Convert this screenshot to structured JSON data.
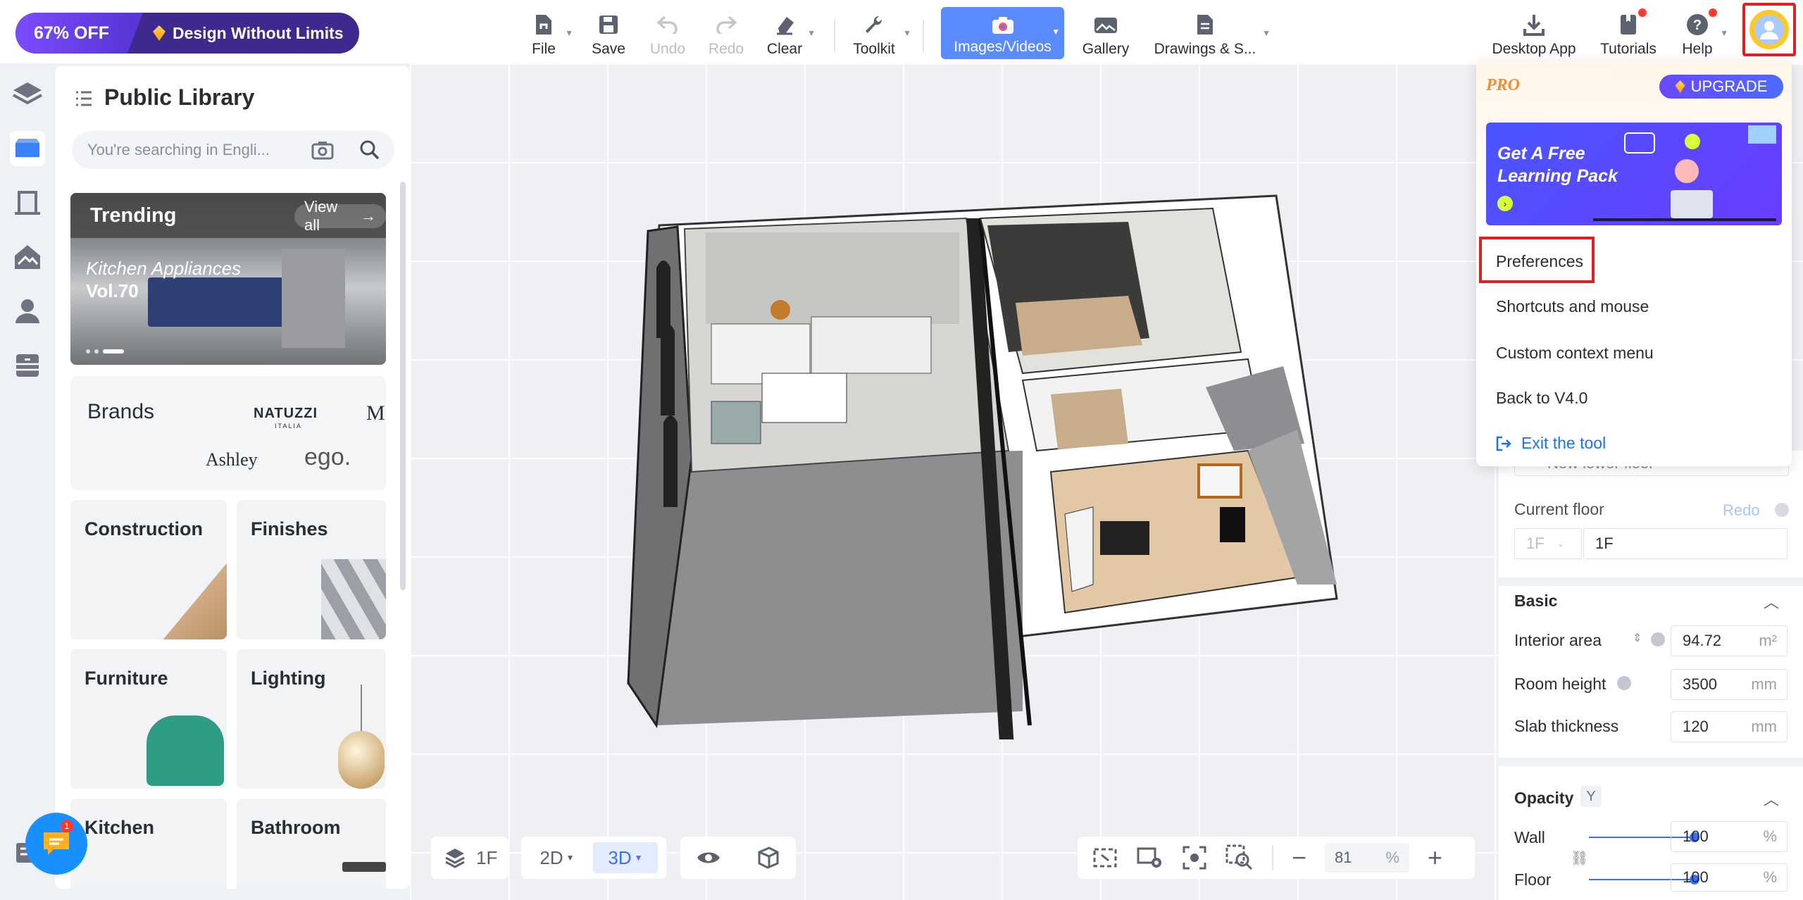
{
  "promo": {
    "discount": "67% OFF",
    "message": "Design Without Limits"
  },
  "toolbar": {
    "file": "File",
    "save": "Save",
    "undo": "Undo",
    "redo": "Redo",
    "clear": "Clear",
    "toolkit": "Toolkit",
    "images_videos": "Images/Videos",
    "gallery": "Gallery",
    "drawings": "Drawings & S...",
    "desktop_app": "Desktop App",
    "tutorials": "Tutorials",
    "help": "Help"
  },
  "library": {
    "title": "Public Library",
    "search_placeholder": "You're searching in Engli...",
    "trending": {
      "label": "Trending",
      "view_all": "View all",
      "feature_line1": "Kitchen Appliances",
      "feature_line2": "Vol.70"
    },
    "brands": {
      "label": "Brands",
      "logos": [
        "NATUZZI",
        "ITALIA",
        "Ashley",
        "ego.",
        "M"
      ]
    },
    "categories": [
      "Construction",
      "Finishes",
      "Furniture",
      "Lighting",
      "Kitchen",
      "Bathroom"
    ]
  },
  "bottom": {
    "floor": "1F",
    "view_2d": "2D",
    "view_3d": "3D",
    "zoom": "81",
    "zoom_unit": "%"
  },
  "panel": {
    "new_lower_floor": "New lower floor",
    "current_floor_label": "Current floor",
    "redo": "Redo",
    "floor_select": "1F",
    "floor_name": "1F",
    "basic_title": "Basic",
    "interior_area_label": "Interior area",
    "interior_area": "94.72",
    "area_unit": "m²",
    "room_height_label": "Room height",
    "room_height": "3500",
    "slab_label": "Slab thickness",
    "slab": "120",
    "mm": "mm",
    "opacity_title": "Opacity",
    "opacity_key": "Y",
    "wall_label": "Wall",
    "wall_value": "100",
    "floor_label": "Floor",
    "floor_value": "100",
    "pct": "%"
  },
  "opacity_levels": {
    "wall": 1.0,
    "floor": 1.0
  },
  "dropdown": {
    "pro": "PRO",
    "upgrade": "UPGRADE",
    "banner_line1": "Get A Free",
    "banner_line2": "Learning Pack",
    "items": [
      "Preferences",
      "Shortcuts and mouse",
      "Custom context menu",
      "Back to V4.0"
    ],
    "exit": "Exit the tool"
  },
  "chat_badge": "1",
  "colors": {
    "accent": "#5b8cff",
    "promo": "#3d2a8c",
    "highlight": "#e02020",
    "link": "#1a73e8"
  }
}
